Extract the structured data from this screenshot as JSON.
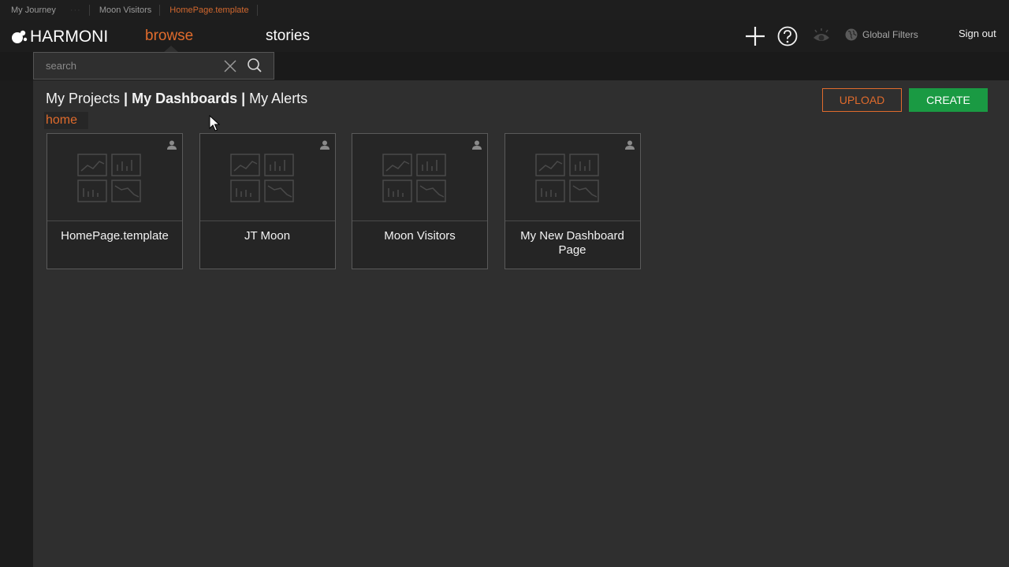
{
  "journey": {
    "items": [
      "My Journey",
      "Moon Visitors",
      "HomePage.template"
    ]
  },
  "nav": {
    "logo": "HARMONI",
    "browse": "browse",
    "stories": "stories",
    "global_filters": "Global Filters",
    "sign_out": "Sign out"
  },
  "search": {
    "placeholder": "search",
    "value": ""
  },
  "tabs": {
    "projects": "My Projects",
    "sep1": " | ",
    "dashboards": "My Dashboards",
    "sep2": " | ",
    "alerts": "My Alerts"
  },
  "breadcrumb": "home",
  "buttons": {
    "upload": "UPLOAD",
    "create": "CREATE"
  },
  "dashboards": [
    {
      "title": "HomePage.template"
    },
    {
      "title": "JT Moon"
    },
    {
      "title": "Moon Visitors"
    },
    {
      "title": "My New Dashboard Page"
    }
  ],
  "colors": {
    "accent": "#e06b2c",
    "create": "#1a9a43",
    "background": "#2f2f2f"
  },
  "icons": [
    "harmoni-logo-icon",
    "plus-icon",
    "help-icon",
    "eye-icon",
    "globe-icon",
    "close-icon",
    "search-icon",
    "user-icon",
    "dashboard-thumbnail-icon",
    "mouse-cursor-icon"
  ]
}
